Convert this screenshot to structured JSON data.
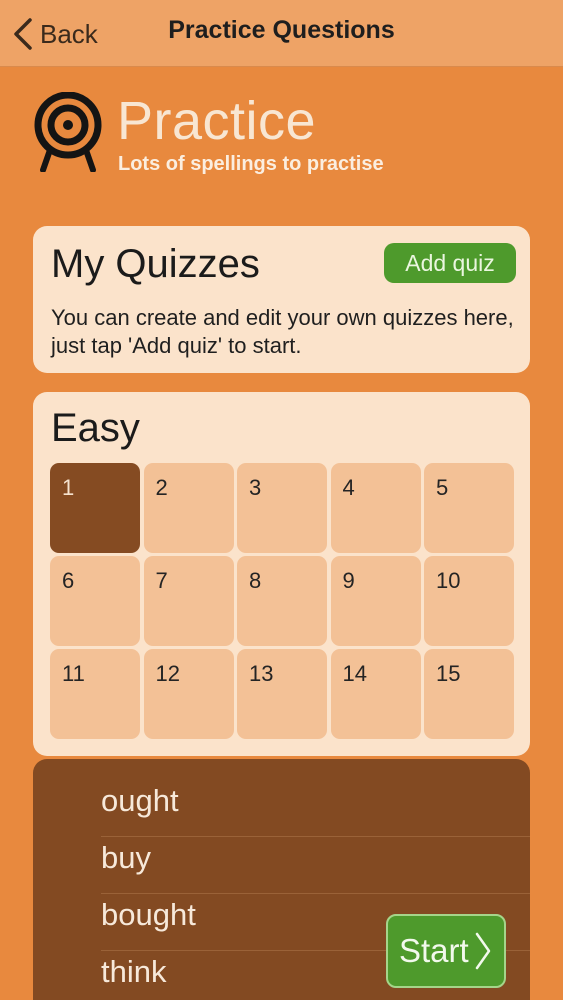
{
  "nav": {
    "back_label": "Back",
    "title": "Practice Questions"
  },
  "hero": {
    "title": "Practice",
    "subtitle": "Lots of spellings to practise"
  },
  "my_quizzes": {
    "title": "My Quizzes",
    "add_label": "Add quiz",
    "description": "You can create and edit your own quizzes here, just tap 'Add quiz' to start."
  },
  "easy": {
    "title": "Easy",
    "selected": "1",
    "quizzes": [
      "1",
      "2",
      "3",
      "4",
      "5",
      "6",
      "7",
      "8",
      "9",
      "10",
      "11",
      "12",
      "13",
      "14",
      "15"
    ]
  },
  "words": [
    "ought",
    "buy",
    "bought",
    "think"
  ],
  "start_label": "Start",
  "colors": {
    "background": "#e8893e",
    "card": "#fbe3cb",
    "cell": "#f3c196",
    "selected_cell": "#854b22",
    "green_button": "#4e9a2c",
    "word_panel": "#834a22"
  }
}
